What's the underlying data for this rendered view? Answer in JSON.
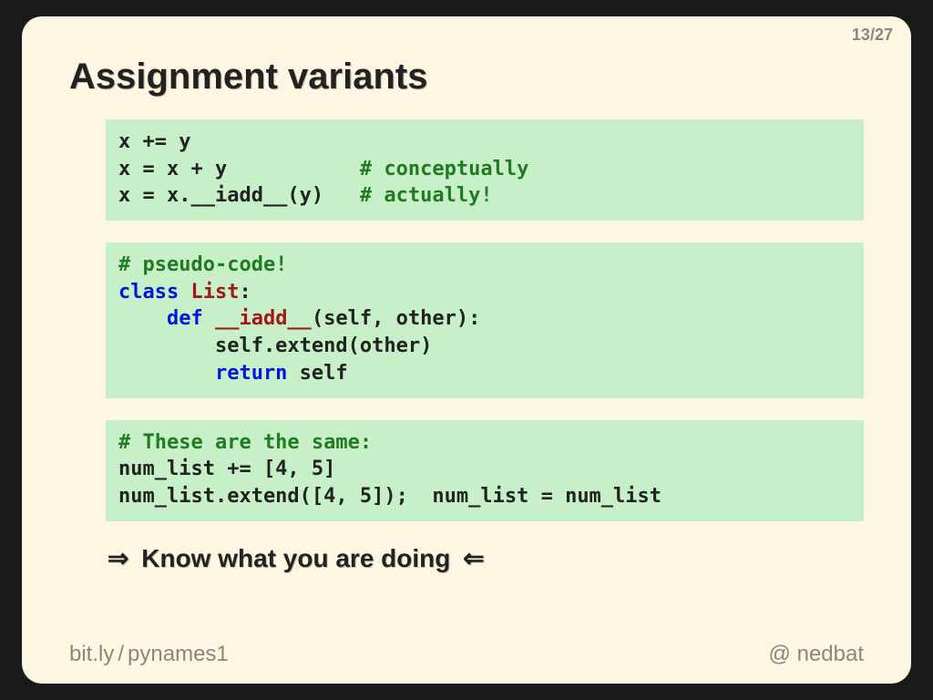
{
  "page": {
    "current": "13",
    "total": "27"
  },
  "title": "Assignment variants",
  "code1": {
    "l1": "x += y",
    "l2a": "x = x + y           ",
    "l2b": "# conceptually",
    "l3a": "x = x.__iadd__(y)   ",
    "l3b": "# actually!"
  },
  "code2": {
    "l1": "# pseudo-code!",
    "l2a": "class",
    "l2b": " List",
    "l2c": ":",
    "l3a": "    def",
    "l3b": " __iadd__",
    "l3c": "(self, other):",
    "l4": "        self.extend(other)",
    "l5a": "        return",
    "l5b": " self"
  },
  "code3": {
    "l1": "# These are the same:",
    "l2": "num_list += [4, 5]",
    "l3": "num_list.extend([4, 5]);  num_list = num_list"
  },
  "takeaway": {
    "left_arrow": "⇒",
    "text": "Know what you are doing",
    "right_arrow": "⇐"
  },
  "footer": {
    "link_host": "bit.ly",
    "link_sep": "/",
    "link_path": "pynames1",
    "at": "@",
    "handle": "nedbat"
  }
}
